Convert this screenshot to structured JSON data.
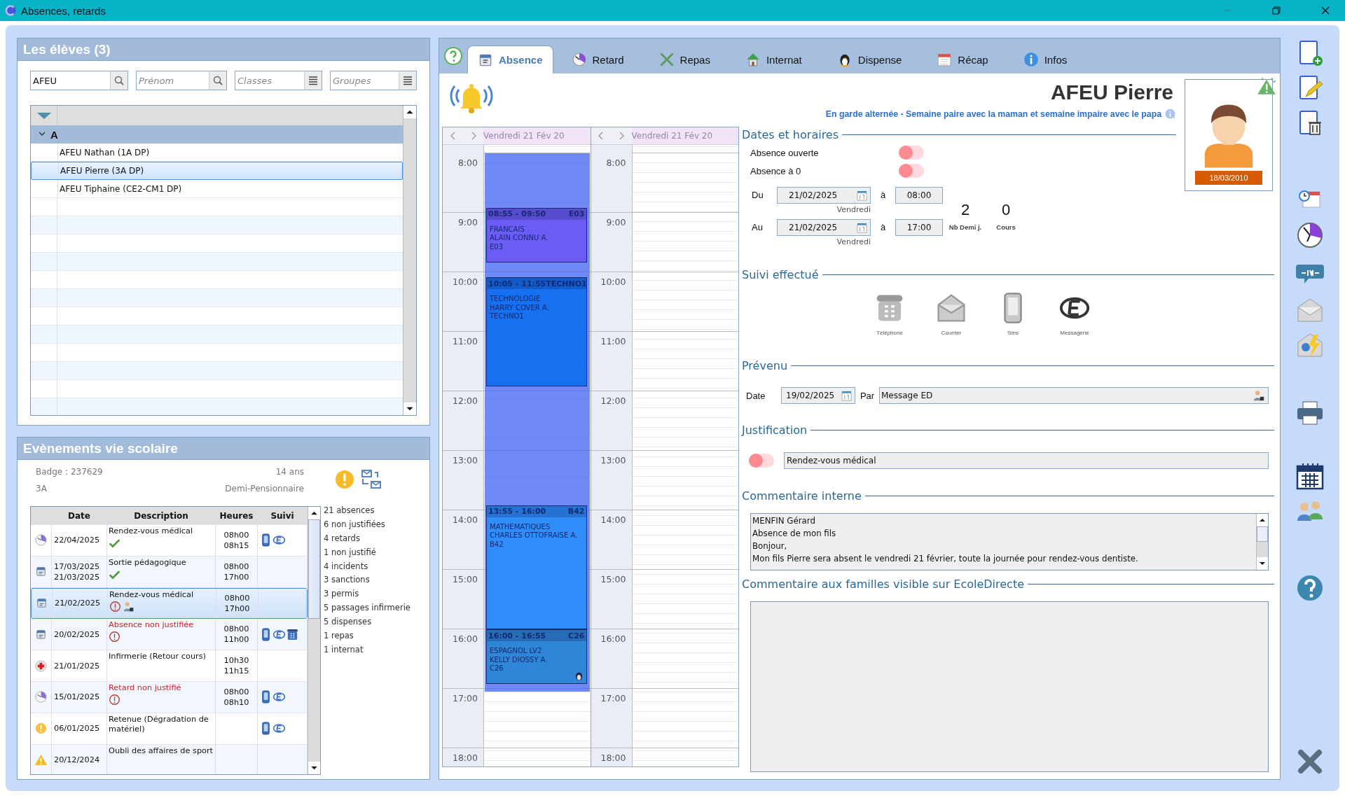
{
  "window": {
    "title": "Absences, retards"
  },
  "students": {
    "title": "Les élèves (3)",
    "filters": [
      {
        "kind": "search",
        "value": "AFEU"
      },
      {
        "kind": "search",
        "placeholder": "Prénom"
      },
      {
        "kind": "list",
        "placeholder": "Classes"
      },
      {
        "kind": "list",
        "placeholder": "Groupes"
      }
    ],
    "groups": [
      {
        "label": "A",
        "expanded": true,
        "children": [
          {
            "label": "AFEU Nathan (1A DP)",
            "selected": false
          },
          {
            "label": "AFEU Pierre (3A DP)",
            "selected": true
          },
          {
            "label": "AFEU Tiphaine (CE2-CM1 DP)",
            "selected": false
          }
        ]
      }
    ]
  },
  "events": {
    "title": "Evènements vie scolaire",
    "badge": "Badge : 237629",
    "age": "14 ans",
    "class": "3A",
    "regime": "Demi-Pensionnaire",
    "columns": [
      "Date",
      "Description",
      "Heures",
      "Suivi"
    ],
    "rows": [
      {
        "kind": "retard",
        "dates": [
          "22/04/2025"
        ],
        "description": "Rendez-vous médical",
        "unjustified": false,
        "marks": [
          {
            "kind": "check"
          }
        ],
        "hours": [
          "08h00",
          "08h15"
        ],
        "suivi": [
          {
            "kind": "sms"
          },
          {
            "kind": "ed"
          }
        ],
        "selected": false
      },
      {
        "kind": "absence",
        "dates": [
          "17/03/2025",
          "21/03/2025"
        ],
        "description": "Sortie pédagogique",
        "unjustified": false,
        "marks": [
          {
            "kind": "check"
          }
        ],
        "hours": [
          "08h00",
          "17h00"
        ],
        "selected": false
      },
      {
        "kind": "absence",
        "dates": [
          "21/02/2025"
        ],
        "description": "Rendez-vous médical",
        "unjustified": false,
        "marks": [
          {
            "kind": "alert"
          },
          {
            "kind": "person"
          }
        ],
        "hours": [
          "08h00",
          "17h00"
        ],
        "selected": true
      },
      {
        "kind": "absence",
        "dates": [
          "20/02/2025"
        ],
        "description": "Absence non justifiée",
        "unjustified": true,
        "marks": [
          {
            "kind": "alert"
          }
        ],
        "hours": [
          "08h00",
          "11h00"
        ],
        "suivi": [
          {
            "kind": "sms"
          },
          {
            "kind": "ed"
          },
          {
            "kind": "phone"
          }
        ],
        "selected": false
      },
      {
        "kind": "infirmerie",
        "dates": [
          "21/01/2025"
        ],
        "description": "Infirmerie (Retour cours)",
        "unjustified": false,
        "hours": [
          "10h30",
          "11h15"
        ],
        "selected": false
      },
      {
        "kind": "retard",
        "dates": [
          "15/01/2025"
        ],
        "description": "Retard non justifié",
        "unjustified": true,
        "marks": [
          {
            "kind": "alert"
          }
        ],
        "hours": [
          "08h00",
          "08h10"
        ],
        "suivi": [
          {
            "kind": "sms"
          },
          {
            "kind": "ed"
          }
        ],
        "selected": false
      },
      {
        "kind": "sanction",
        "dates": [
          "06/01/2025"
        ],
        "description": "Retenue (Dégradation de matériel)",
        "unjustified": false,
        "suivi": [
          {
            "kind": "sms"
          },
          {
            "kind": "ed"
          }
        ],
        "selected": false
      },
      {
        "kind": "oubli",
        "dates": [
          "20/12/2024"
        ],
        "description": "Oubli des affaires de sport",
        "unjustified": false,
        "selected": false
      }
    ],
    "stats": [
      "21 absences",
      "6 non justifiées",
      "4 retards",
      "1 non justifié",
      "4 incidents",
      "3 sanctions",
      "3 permis",
      "5 passages infirmerie",
      "5 dispenses",
      "1 repas",
      "1 internat"
    ]
  },
  "tabs": [
    {
      "kind": "absence",
      "label": "Absence",
      "selected": true
    },
    {
      "kind": "retard",
      "label": "Retard",
      "selected": false
    },
    {
      "kind": "repas",
      "label": "Repas",
      "selected": false
    },
    {
      "kind": "internat",
      "label": "Internat",
      "selected": false
    },
    {
      "kind": "dispense",
      "label": "Dispense",
      "selected": false
    },
    {
      "kind": "recap",
      "label": "Récap",
      "selected": false
    },
    {
      "kind": "infos",
      "label": "Infos",
      "selected": false
    }
  ],
  "calendar": {
    "days": [
      {
        "title": "Vendredi 21 Fév 20",
        "absence_marked": true,
        "hours": [
          "8:00",
          "9:00",
          "10:00",
          "11:00",
          "12:00",
          "13:00",
          "14:00",
          "15:00",
          "16:00",
          "17:00",
          "18:00"
        ],
        "courses": [
          {
            "time": "08:55 - 09:50",
            "room": "E03",
            "lines": [
              "FRANCAIS",
              "ALAIN CONNU A.",
              "E03"
            ],
            "color": "#6b5cf6",
            "dispense": false
          },
          {
            "time": "10:05 - 11:55",
            "room": "TECHNO1",
            "lines": [
              "TECHNOLOGIE",
              "HARRY COVER A.",
              "TECHNO1"
            ],
            "color": "#1670f0",
            "dispense": false
          },
          {
            "time": "13:55 - 16:00",
            "room": "B42",
            "lines": [
              "MATHEMATIQUES",
              "CHARLES OTTOFRAISE A.",
              "B42"
            ],
            "color": "#2f8cf8",
            "dispense": false
          },
          {
            "time": "16:00 - 16:55",
            "room": "C26",
            "lines": [
              "ESPAGNOL LV2",
              "KELLY DIOSSY A.",
              "C26"
            ],
            "color": "#2f86d6",
            "dispense": true
          }
        ]
      },
      {
        "title": "Vendredi 21 Fév 20",
        "absence_marked": false,
        "hours": [
          "8:00",
          "9:00",
          "10:00",
          "11:00",
          "12:00",
          "13:00",
          "14:00",
          "15:00",
          "16:00",
          "17:00",
          "18:00"
        ]
      }
    ]
  },
  "student": {
    "name": "AFEU Pierre",
    "note": "En garde alternée - Semaine paire avec la maman et semaine impaire avec le papa",
    "birthdate": "18/03/2010",
    "alert": true
  },
  "dates": {
    "title": "Dates et horaires",
    "toggles": [
      {
        "label": "Absence ouverte",
        "on": false
      },
      {
        "label": "Absence à 0",
        "on": false
      }
    ],
    "ranges": [
      {
        "label": "Du",
        "date": "21/02/2025",
        "weekday": "Vendredi",
        "sep": "à",
        "time": "08:00"
      },
      {
        "label": "Au",
        "date": "21/02/2025",
        "weekday": "Vendredi",
        "sep": "à",
        "time": "17:00"
      }
    ],
    "counts": [
      {
        "value": "2",
        "label": "Nb Demi j."
      },
      {
        "value": "0",
        "label": "Cours"
      }
    ]
  },
  "suivi": {
    "title": "Suivi effectué",
    "channels": [
      {
        "kind": "phone",
        "label": "Téléphone",
        "done": false
      },
      {
        "kind": "mail",
        "label": "Courrier",
        "done": false
      },
      {
        "kind": "sms",
        "label": "Sms",
        "done": false
      },
      {
        "kind": "ed",
        "label": "Messagerie",
        "done": false
      }
    ]
  },
  "prevenu": {
    "title": "Prévenu",
    "date_label": "Date",
    "date": "19/02/2025",
    "by_label": "Par",
    "by": "Message ED"
  },
  "justification": {
    "title": "Justification",
    "on": false,
    "value": "Rendez-vous médical"
  },
  "internal_comment": {
    "title": "Commentaire interne",
    "lines": [
      "MENFIN Gérard",
      "Absence de mon fils",
      "Bonjour,",
      "Mon fils Pierre sera absent le vendredi 21 février, toute la journée pour rendez-vous dentiste."
    ]
  },
  "family_comment": {
    "title": "Commentaire aux familles visible sur EcoleDirecte"
  }
}
